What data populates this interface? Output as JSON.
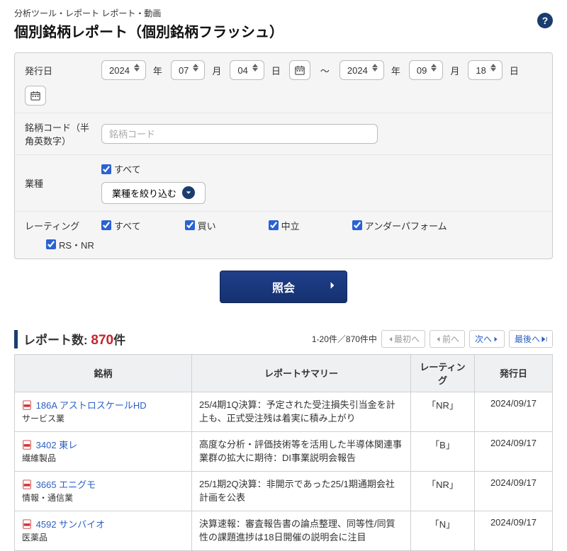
{
  "breadcrumb": "分析ツール・レポート レポート・動画",
  "page_title": "個別銘柄レポート（個別銘柄フラッシュ）",
  "labels": {
    "issue_date": "発行日",
    "stock_code": "銘柄コード（半角英数字）",
    "industry": "業種",
    "rating": "レーティング",
    "year": "年",
    "month": "月",
    "day": "日",
    "tilde": "〜",
    "all": "すべて",
    "refine_industry": "業種を絞り込む",
    "rating_buy": "買い",
    "rating_neutral": "中立",
    "rating_underperform": "アンダーパフォーム",
    "rating_rsnr": "RS・NR",
    "submit": "照会",
    "code_placeholder": "銘柄コード"
  },
  "date_from": {
    "year": "2024",
    "month": "07",
    "day": "04"
  },
  "date_to": {
    "year": "2024",
    "month": "09",
    "day": "18"
  },
  "results": {
    "title": "レポート数:",
    "count": "870",
    "unit": "件",
    "range": "1-20件／870件中",
    "pager": {
      "first": "最初へ",
      "prev": "前へ",
      "next": "次へ",
      "last": "最後へ"
    },
    "columns": {
      "stock": "銘柄",
      "summary": "レポートサマリー",
      "rating": "レーティング",
      "date": "発行日"
    },
    "rows": [
      {
        "code": "186A",
        "name": "アストロスケールHD",
        "sector": "サービス業",
        "summary": "25/4期1Q決算：予定された受注損失引当金を計上も、正式受注残は着実に積み上がり",
        "rating": "「NR」",
        "date": "2024/09/17"
      },
      {
        "code": "3402",
        "name": "東レ",
        "sector": "繊維製品",
        "summary": "高度な分析・評価技術等を活用した半導体関連事業群の拡大に期待：DI事業説明会報告",
        "rating": "「B」",
        "date": "2024/09/17"
      },
      {
        "code": "3665",
        "name": "エニグモ",
        "sector": "情報・通信業",
        "summary": "25/1期2Q決算：非開示であった25/1期通期会社計画を公表",
        "rating": "「NR」",
        "date": "2024/09/17"
      },
      {
        "code": "4592",
        "name": "サンバイオ",
        "sector": "医薬品",
        "summary": "決算速報：審査報告書の論点整理、同等性/同質性の課題進捗は18日開催の説明会に注目",
        "rating": "「N」",
        "date": "2024/09/17"
      }
    ]
  }
}
